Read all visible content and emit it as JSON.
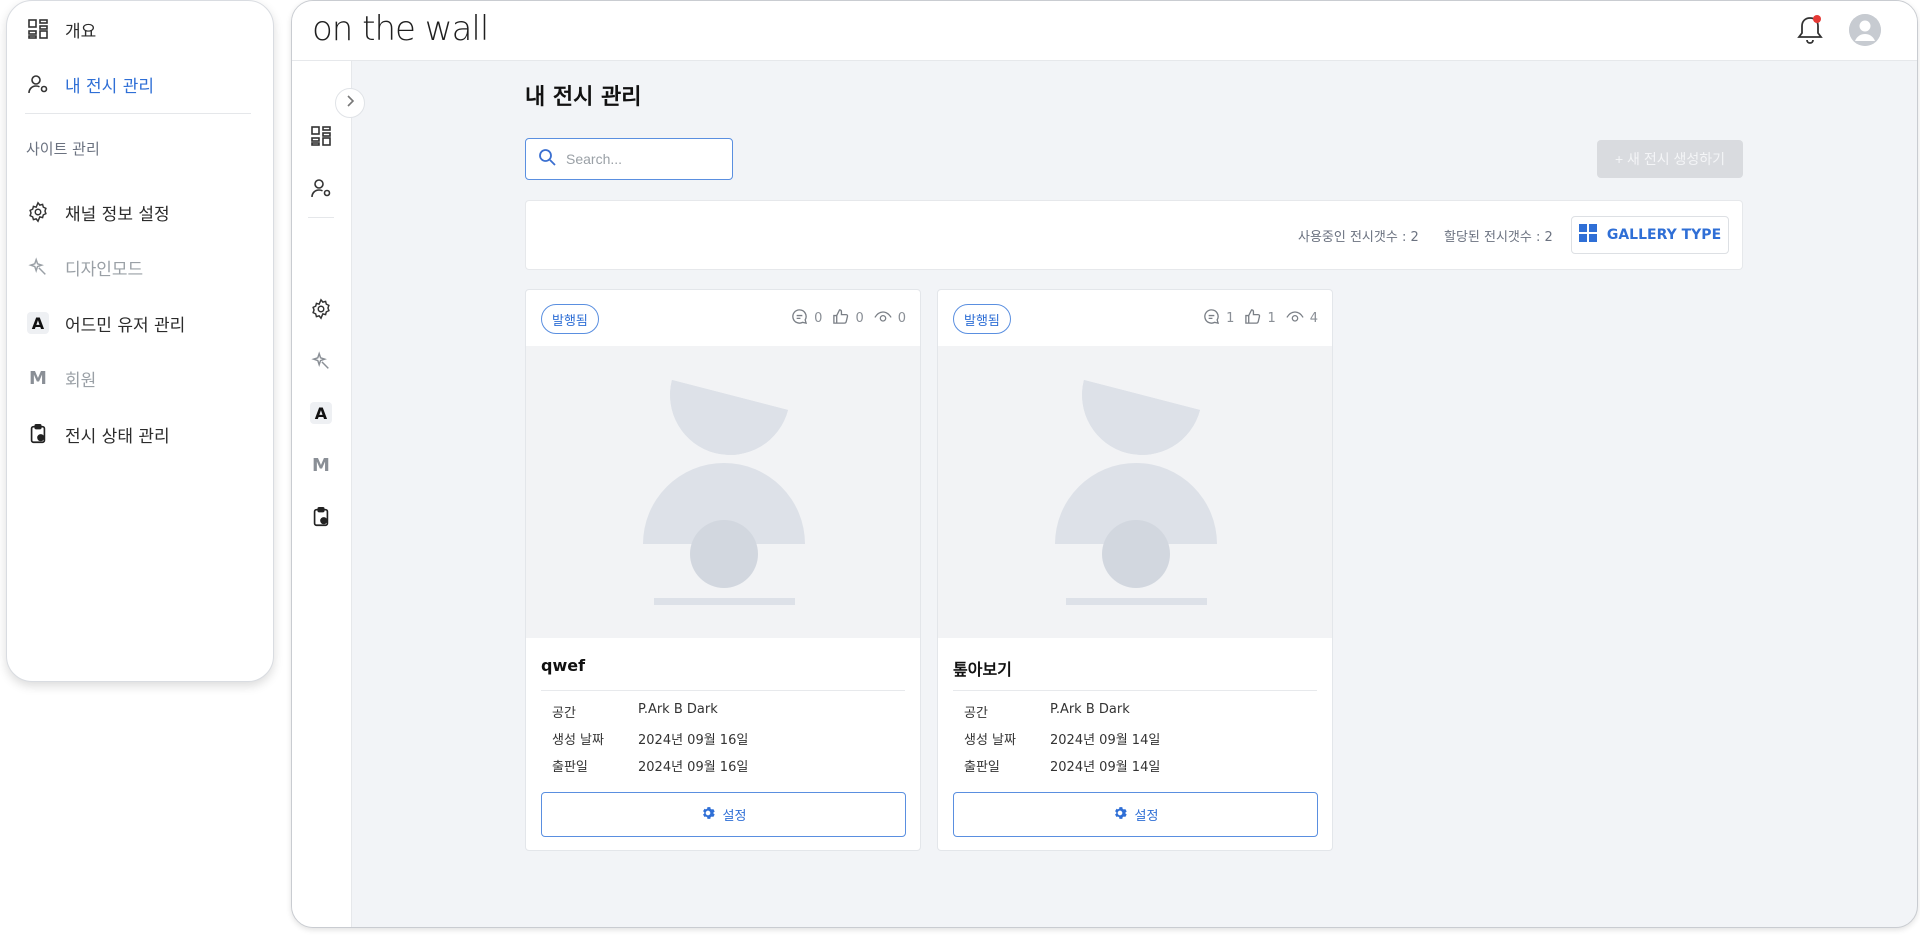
{
  "menu": {
    "items": [
      {
        "label": "개요",
        "icon": "grid-icon"
      },
      {
        "label": "내 전시 관리",
        "icon": "user-location-icon",
        "active": true
      }
    ],
    "section_label": "사이트 관리",
    "site_items": [
      {
        "label": "채널 정보 설정",
        "icon": "gear-icon"
      },
      {
        "label": "디자인모드",
        "icon": "sparkle-icon",
        "muted": true
      },
      {
        "label": "어드민 유저 관리",
        "icon": "letter-a-icon"
      },
      {
        "label": "회원",
        "icon": "letter-m-icon",
        "muted": true
      },
      {
        "label": "전시 상태 관리",
        "icon": "clipboard-icon"
      }
    ],
    "letter_a": "A",
    "letter_m": "M"
  },
  "topbar": {
    "logo": "on the wall"
  },
  "main": {
    "title": "내 전시 관리",
    "search_placeholder": "Search...",
    "new_button": "+ 새 전시 생성하기",
    "stats": {
      "in_use": "사용중인 전시갯수 : 2",
      "allocated": "할당된 전시갯수 : 2",
      "view_button": "GALLERY TYPE"
    },
    "cards": [
      {
        "status": "발행됨",
        "comments": "0",
        "likes": "0",
        "views": "0",
        "title": "qwef",
        "space_label": "공간",
        "space": "P.Ark B Dark",
        "created_label": "생성 날짜",
        "created": "2024년 09월 16일",
        "published_label": "출판일",
        "published": "2024년 09월 16일",
        "settings_label": "설정"
      },
      {
        "status": "발행됨",
        "comments": "1",
        "likes": "1",
        "views": "4",
        "title": "톺아보기",
        "space_label": "공간",
        "space": "P.Ark B Dark",
        "created_label": "생성 날짜",
        "created": "2024년 09월 14일",
        "published_label": "출판일",
        "published": "2024년 09월 14일",
        "settings_label": "설정"
      }
    ]
  },
  "colors": {
    "accent": "#2f6fd6",
    "background": "#f2f4f7",
    "notification_dot": "#e53935"
  }
}
